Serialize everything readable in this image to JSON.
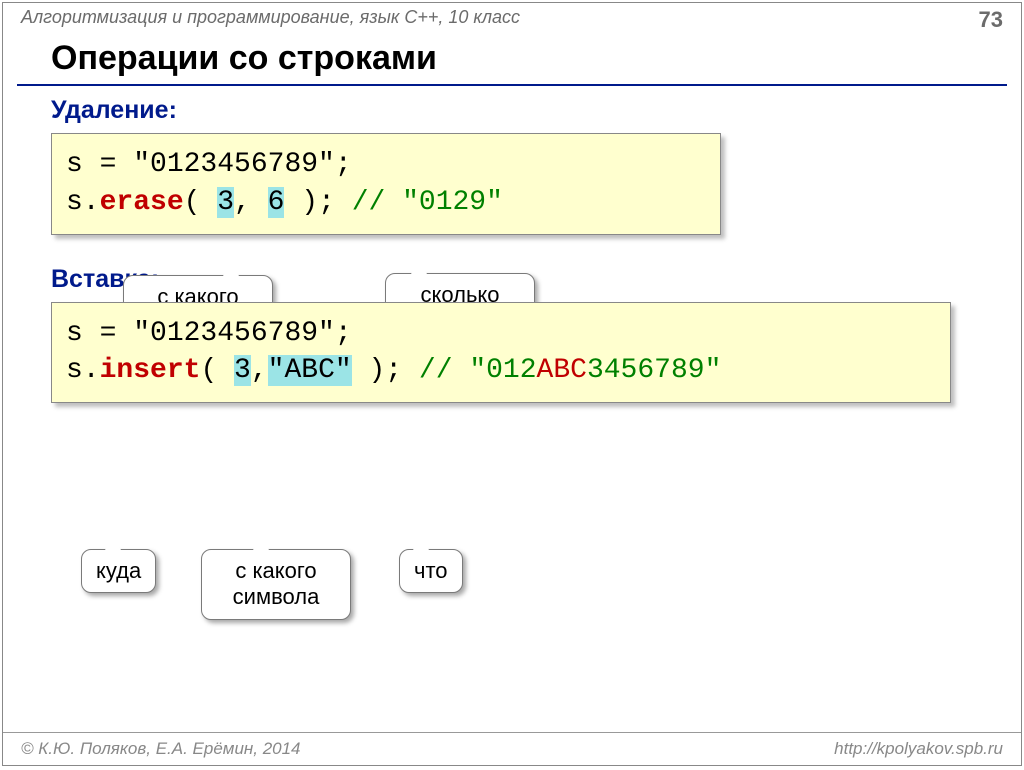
{
  "header": {
    "course": "Алгоритмизация и программирование, язык C++, 10 класс",
    "page": "73"
  },
  "title": "Операции со строками",
  "sections": {
    "delete_label": "Удаление:",
    "insert_label": "Вставка:"
  },
  "code1": {
    "l1a": "s = ",
    "l1b": "\"0123456789\"",
    "l1c": ";",
    "l2a": "s.",
    "l2b": "erase",
    "l2c": "( ",
    "l2arg1": "3",
    "l2comma": ", ",
    "l2arg2": "6",
    "l2d": " ); ",
    "l2comment": "// \"0129\""
  },
  "callouts1": {
    "from": "с какого символа",
    "count": "сколько символов"
  },
  "code2": {
    "l1a": "s = ",
    "l1b": "\"0123456789\"",
    "l1c": ";",
    "l2a": "s.",
    "l2b": "insert",
    "l2c": "( ",
    "l2arg1": "3",
    "l2comma": ",",
    "l2arg2": "\"ABC\"",
    "l2d": " ); ",
    "l2comment_a": "// \"012",
    "l2comment_b": "ABC",
    "l2comment_c": "3456789\""
  },
  "callouts2": {
    "where": "куда",
    "from": "с какого символа",
    "what": "что"
  },
  "footer": {
    "left": "© К.Ю. Поляков, Е.А. Ерёмин, 2014",
    "right": "http://kpolyakov.spb.ru"
  }
}
